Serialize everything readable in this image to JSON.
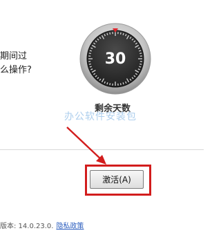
{
  "prompt": {
    "line1": "期间过",
    "line2": "么操作?"
  },
  "countdown": {
    "value": "30",
    "caption": "剩余天数"
  },
  "watermark": "办公软件安装包",
  "activate_button": {
    "label": "激活(A)"
  },
  "footer": {
    "version_text": "版本: 14.0.23.0.",
    "privacy_link": "隐私政策"
  },
  "colors": {
    "highlight_red": "#d21d1d",
    "dial_face": "#2f2f2f",
    "dial_marker": "#e0262d",
    "link": "#2d5fbf"
  }
}
